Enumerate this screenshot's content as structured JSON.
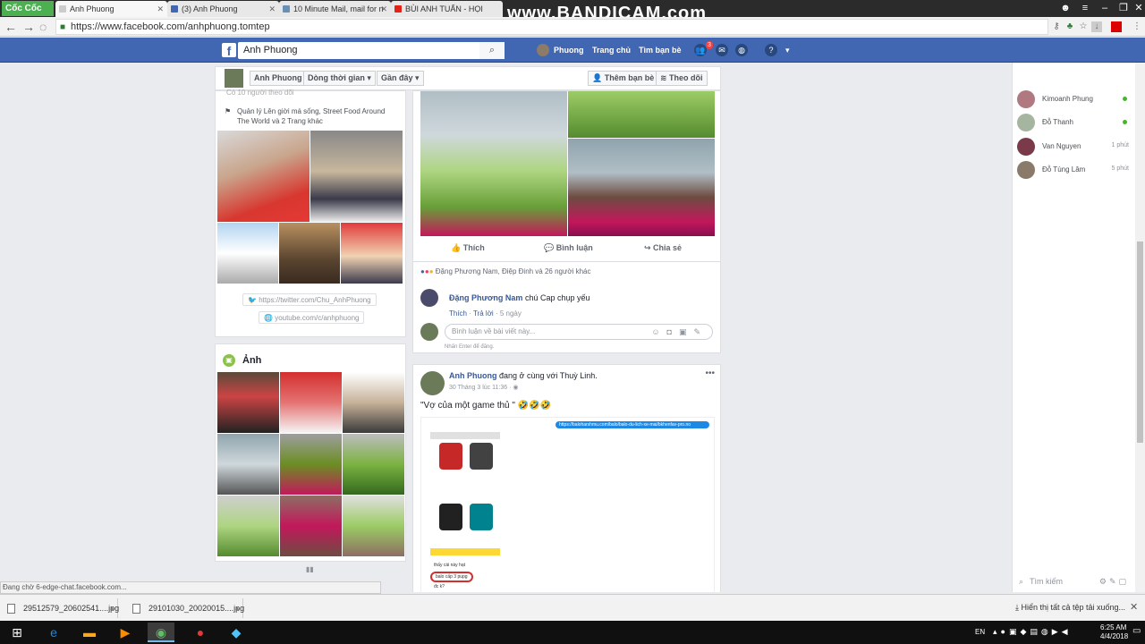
{
  "browser": {
    "logo_text": "Cốc Cốc",
    "tabs": [
      {
        "label": "Anh Phuong",
        "active": true
      },
      {
        "label": "(3) Anh Phuong",
        "active": false
      },
      {
        "label": "10 Minute Mail, mail for n",
        "active": false
      },
      {
        "label": "BÙI ANH TUẤN - HỌI",
        "active": false
      }
    ],
    "watermark": "www.BANDICAM.com",
    "url": "https://www.facebook.com/anhphuong.tomtep"
  },
  "fb": {
    "logo": "f",
    "search_value": "Anh Phuong",
    "nav": {
      "user": "Phuong",
      "home": "Trang chủ",
      "find_friends": "Tìm bạn bè"
    },
    "notification_count": "3"
  },
  "timeline_nav": {
    "name": "Anh Phuong",
    "filter1": "Dòng thời gian ▾",
    "filter2": "Gần đây ▾",
    "add_friend": "Thêm bạn bè",
    "follow": "Theo dõi"
  },
  "intro": {
    "line1": "Có 10 người theo dõi",
    "manages_line1": "Quản lý Lên giời má sống, Street Food Around",
    "manages_line2": "The World và 2 Trang khác",
    "twitter": "https://twitter.com/Chu_AnhPhuong",
    "youtube": "youtube.com/c/anhphuong"
  },
  "photos_section": {
    "title": "Ảnh"
  },
  "post1": {
    "like": "Thích",
    "comment": "Bình luận",
    "share": "Chia sẻ",
    "reactions": "Đặng Phương Nam, Điệp Đinh và 26 người khác",
    "comment_author": "Đặng Phương Nam",
    "comment_text": "chú Cap chụp yếu",
    "comment_like": "Thích",
    "comment_reply": "Trả lời",
    "comment_time": "5 ngày",
    "input_placeholder": "Bình luận về bài viết này...",
    "hint": "Nhấn Enter để đăng."
  },
  "post2": {
    "author": "Anh Phuong",
    "with_text": "đang ở cùng với Thuỳ Linh.",
    "meta": "30 Tháng 3 lúc 11:36 · ",
    "text": "\"Vợ của một game thủ \" 🤣🤣🤣",
    "chat_url": "https://baloharshmu.com/balo/balo-du-lich-xe-mai/bkhenfav-pro.no",
    "bag_caption": "thấy cái này hạt",
    "bag_circled": "balo cấp 3 pupg",
    "bag_reply": "đc k?"
  },
  "chat": {
    "contacts": [
      {
        "name": "Kimoanh Phung",
        "status": "",
        "online": true
      },
      {
        "name": "Đỗ Thanh",
        "status": "",
        "online": true
      },
      {
        "name": "Van Nguyen",
        "status": "1 phút",
        "online": false
      },
      {
        "name": "Đỗ Tùng Lâm",
        "status": "5 phút",
        "online": false
      }
    ],
    "search_placeholder": "Tìm kiếm"
  },
  "status_text": "Đang chờ 6-edge-chat.facebook.com...",
  "downloads": {
    "items": [
      "29512579_20602541....jpg",
      "29101030_20020015....jpg"
    ],
    "show_all": "Hiển thị tất cả tệp tải xuống..."
  },
  "taskbar": {
    "lang": "EN",
    "time": "6:25 AM",
    "date": "4/4/2018"
  },
  "colors": {
    "fb_blue": "#4267b2",
    "link": "#365899"
  }
}
